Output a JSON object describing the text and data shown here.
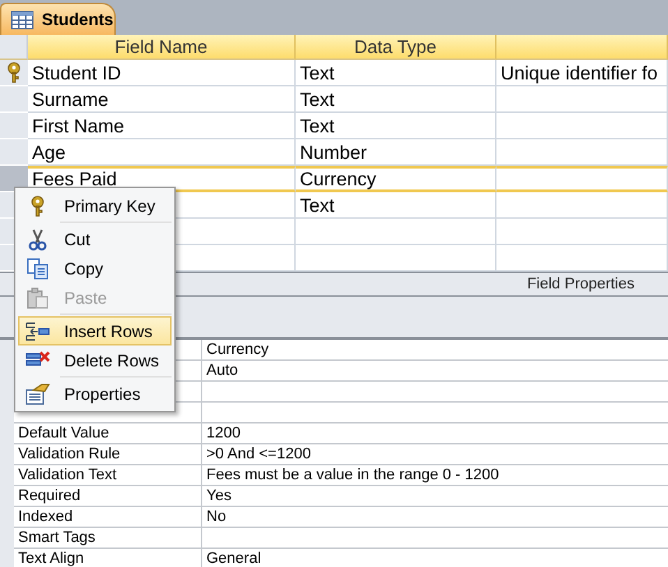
{
  "tab": {
    "title": "Students"
  },
  "grid": {
    "columns": [
      "Field Name",
      "Data Type"
    ],
    "rows": [
      {
        "field_name": "Student ID",
        "data_type": "Text",
        "description": "Unique identifier fo",
        "primary_key": true,
        "selected": false
      },
      {
        "field_name": "Surname",
        "data_type": "Text",
        "selected": false
      },
      {
        "field_name": "First Name",
        "data_type": "Text",
        "selected": false
      },
      {
        "field_name": "Age",
        "data_type": "Number",
        "selected": false
      },
      {
        "field_name": "Fees Paid",
        "data_type": "Currency",
        "selected": true
      },
      {
        "data_type": "Text",
        "selected": false
      },
      {
        "selected": false
      },
      {
        "selected": false
      }
    ]
  },
  "field_properties": {
    "title": "Field Properties",
    "properties": [
      {
        "kind": "row",
        "value": "Currency"
      },
      {
        "kind": "row",
        "value": "Auto"
      },
      {
        "kind": "blank"
      },
      {
        "kind": "blank"
      },
      {
        "kind": "row",
        "label": "Default Value",
        "value": "1200"
      },
      {
        "kind": "row",
        "label": "Validation Rule",
        "value": ">0 And <=1200"
      },
      {
        "kind": "row",
        "label": "Validation Text",
        "value": "Fees must be a value in the range 0 - 1200"
      },
      {
        "kind": "row",
        "label": "Required",
        "value": "Yes"
      },
      {
        "kind": "row",
        "label": "Indexed",
        "value": "No"
      },
      {
        "kind": "row",
        "label": "Smart Tags"
      },
      {
        "kind": "row",
        "label": "Text Align",
        "value": "General"
      }
    ]
  },
  "context_menu": {
    "groups": [
      [
        {
          "label": "Primary Key",
          "kind": "key",
          "disabled": false,
          "selected": false
        }
      ],
      [
        {
          "label": "Cut",
          "kind": "scissors",
          "disabled": false,
          "selected": false
        },
        {
          "label": "Copy",
          "kind": "copy",
          "disabled": false,
          "selected": false
        },
        {
          "label": "Paste",
          "kind": "paste",
          "disabled": true,
          "selected": false
        }
      ],
      [
        {
          "label": "Insert Rows",
          "kind": "insert",
          "disabled": false,
          "selected": true
        },
        {
          "label": "Delete Rows",
          "kind": "delete",
          "disabled": false,
          "selected": false
        }
      ],
      [
        {
          "label": "Properties",
          "kind": "properties",
          "disabled": false,
          "selected": false
        }
      ]
    ]
  }
}
